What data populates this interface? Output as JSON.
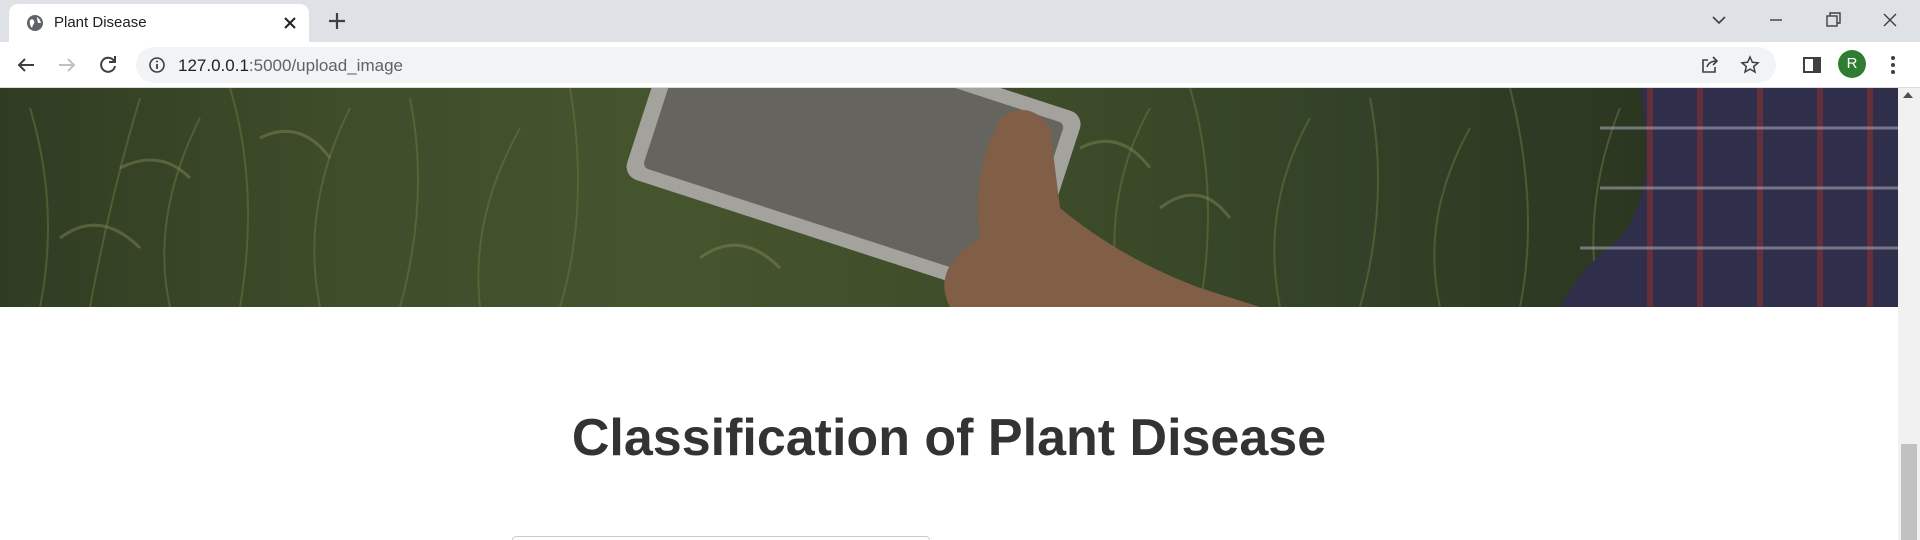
{
  "browser": {
    "tab": {
      "title": "Plant Disease"
    },
    "address_bar": {
      "host": "127.0.0.1",
      "path": ":5000/upload_image"
    },
    "profile_initial": "R"
  },
  "page": {
    "hero": {
      "description": "farm field banner image with tablet"
    },
    "heading": "Classification of Plant Disease"
  }
}
